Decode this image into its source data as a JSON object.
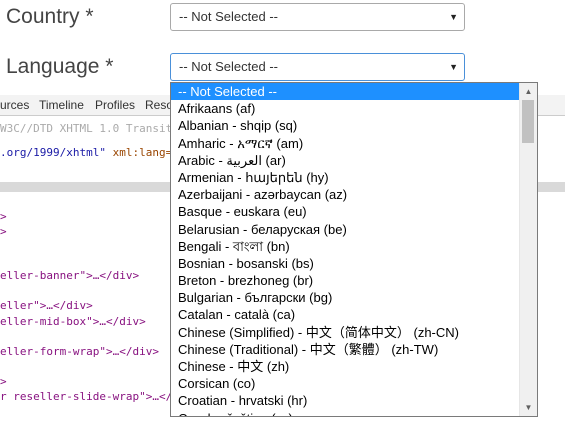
{
  "form": {
    "country": {
      "label": "Country *",
      "value": "-- Not Selected --"
    },
    "language": {
      "label": "Language *",
      "value": "-- Not Selected --"
    }
  },
  "devtools": {
    "tabs": [
      "urces",
      "Timeline",
      "Profiles",
      "Reso"
    ],
    "lines": {
      "doctype": "W3C//DTD XHTML 1.0 Transiti",
      "xmlns_a": ".org/1999/xhtml\"",
      "xmlns_b": " xml:lang=",
      "l1": ">",
      "l2": ">",
      "l3": "eller-banner\">…</div>",
      "l4": "eller\">…</div>",
      "l5": "eller-mid-box\">…</div>",
      "l6": "eller-form-wrap\">…</div>",
      "l7": ">",
      "l8": "r reseller-slide-wrap\">…</d"
    }
  },
  "language_options": [
    "-- Not Selected --",
    "Afrikaans (af)",
    "Albanian - shqip (sq)",
    "Amharic - አማርኛ (am)",
    "Arabic - العربية (ar)",
    "Armenian - հայերեն (hy)",
    "Azerbaijani - azərbaycan (az)",
    "Basque - euskara (eu)",
    "Belarusian - беларуская (be)",
    "Bengali - বাংলা (bn)",
    "Bosnian - bosanski (bs)",
    "Breton - brezhoneg (br)",
    "Bulgarian - български (bg)",
    "Catalan - català (ca)",
    "Chinese (Simplified) - 中文（简体中文） (zh-CN)",
    "Chinese (Traditional) - 中文（繁體） (zh-TW)",
    "Chinese - 中文 (zh)",
    "Corsican (co)",
    "Croatian - hrvatski (hr)",
    "Czech - čeština (cs)"
  ],
  "selected_index": 0
}
